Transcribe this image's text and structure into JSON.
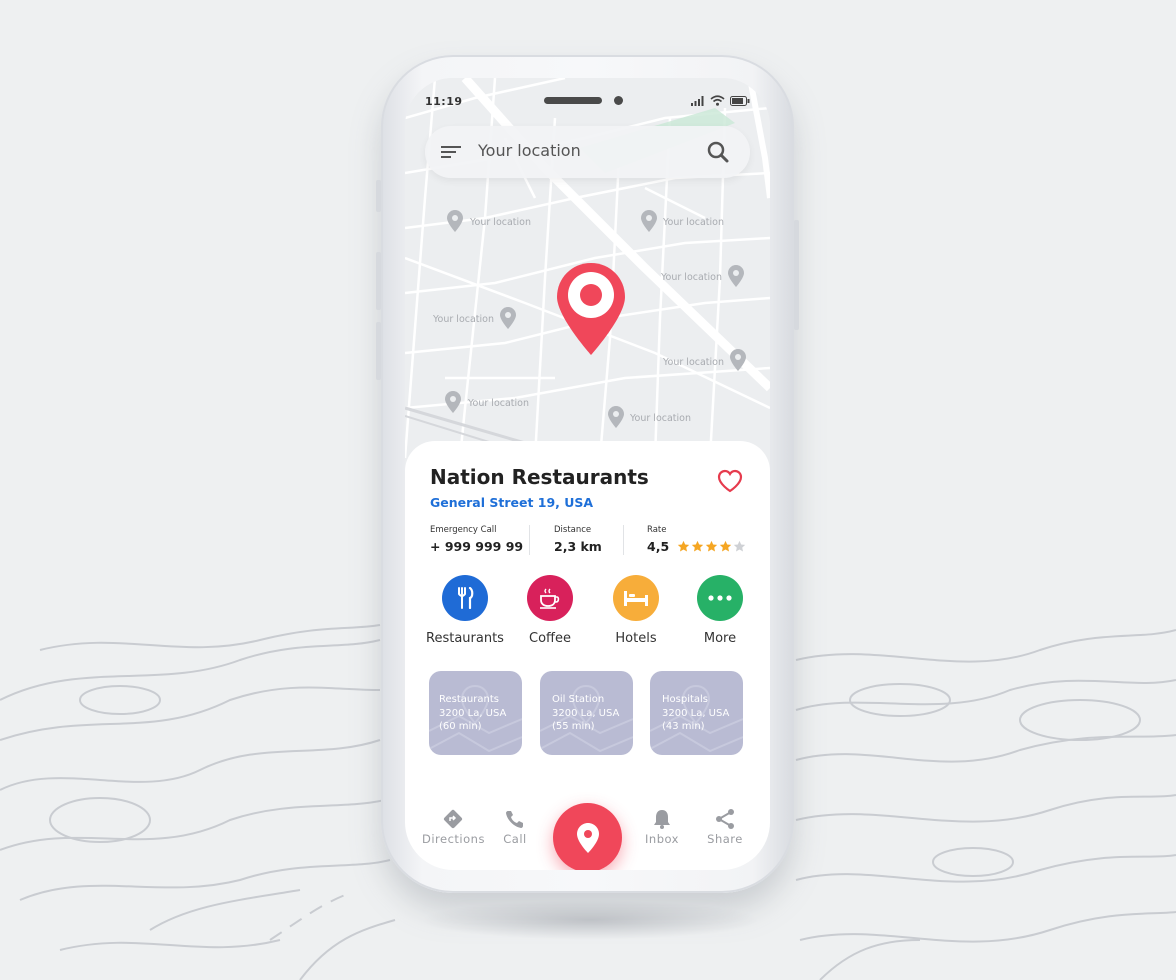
{
  "status_bar": {
    "time": "11:19",
    "icons": [
      "signal-icon",
      "wifi-icon",
      "battery-icon"
    ]
  },
  "search": {
    "placeholder": "Your location",
    "menu_icon": "hamburger-menu-icon",
    "search_icon": "search-icon"
  },
  "map": {
    "pins": [
      {
        "label": "Your location"
      },
      {
        "label": "Your location"
      },
      {
        "label": "Your location"
      },
      {
        "label": "Your location"
      },
      {
        "label": "Your location"
      },
      {
        "label": "Your location"
      },
      {
        "label": "Your location"
      }
    ],
    "selected_pin_icon": "location-pin-icon"
  },
  "place": {
    "title": "Nation Restaurants",
    "address": "General Street 19, USA",
    "favorite_icon": "heart-icon",
    "info": {
      "emergency_label": "Emergency Call",
      "emergency_value": "+ 999 999 99",
      "distance_label": "Distance",
      "distance_value": "2,3 km",
      "rate_label": "Rate",
      "rate_value": "4,5",
      "stars_filled": 4,
      "stars_total": 5
    }
  },
  "categories": [
    {
      "label": "Restaurants",
      "icon": "fork-knife-icon",
      "color": "#1f6bd6"
    },
    {
      "label": "Coffee",
      "icon": "coffee-cup-icon",
      "color": "#d8215b"
    },
    {
      "label": "Hotels",
      "icon": "bed-icon",
      "color": "#f7ad3a"
    },
    {
      "label": "More",
      "icon": "more-dots-icon",
      "color": "#27b167"
    }
  ],
  "nearby": [
    {
      "name": "Restaurants",
      "address": "3200 La, USA",
      "time": "(60 min)"
    },
    {
      "name": "Oil Station",
      "address": "3200 La, USA",
      "time": "(55 min)"
    },
    {
      "name": "Hospitals",
      "address": "3200 La, USA",
      "time": "(43 min)"
    }
  ],
  "bottom_nav": {
    "items": [
      {
        "label": "Directions",
        "icon": "directions-icon"
      },
      {
        "label": "Call",
        "icon": "phone-icon"
      },
      {
        "label": "Inbox",
        "icon": "bell-icon"
      },
      {
        "label": "Share",
        "icon": "share-icon"
      }
    ],
    "fab_icon": "location-pin-icon"
  },
  "colors": {
    "accent_red": "#f0475a",
    "link_blue": "#1e6fd8",
    "star": "#f5a623",
    "star_empty": "#cfd1d5"
  }
}
